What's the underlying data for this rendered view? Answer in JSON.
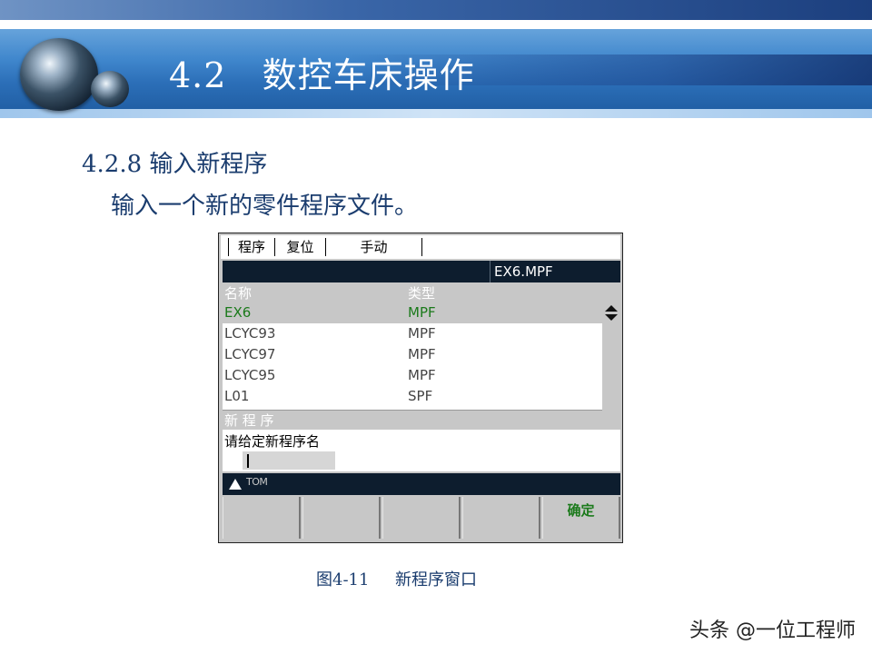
{
  "slide": {
    "title": "4.2   数控车床操作",
    "section_heading": "4.2.8 输入新程序",
    "section_description": "输入一个新的零件程序文件。",
    "caption": "图4-11     新程序窗口",
    "watermark": "头条 @一位工程师"
  },
  "cnc": {
    "mode_tabs": [
      {
        "label": "程序"
      },
      {
        "label": "复位"
      },
      {
        "label": "手动"
      }
    ],
    "current_file": "EX6.MPF",
    "list": {
      "columns": {
        "name": "名称",
        "type": "类型"
      },
      "rows": [
        {
          "name": "EX6",
          "type": "MPF",
          "selected": true
        },
        {
          "name": "LCYC93",
          "type": "MPF"
        },
        {
          "name": "LCYC97",
          "type": "MPF"
        },
        {
          "name": "LCYC95",
          "type": "MPF"
        },
        {
          "name": "L01",
          "type": "SPF"
        }
      ]
    },
    "dialog": {
      "title": "新 程 序",
      "prompt": "请给定新程序名",
      "input_value": ""
    },
    "status": {
      "text": "TOM"
    },
    "softkeys": [
      {
        "label": ""
      },
      {
        "label": ""
      },
      {
        "label": ""
      },
      {
        "label": ""
      },
      {
        "label": "确定"
      }
    ],
    "colors": {
      "dark_bar": "#0d1d2e",
      "panel_gray": "#c7c7c7",
      "selected_text": "#1b7a1b",
      "heading_blue": "#1a3c6e"
    }
  }
}
